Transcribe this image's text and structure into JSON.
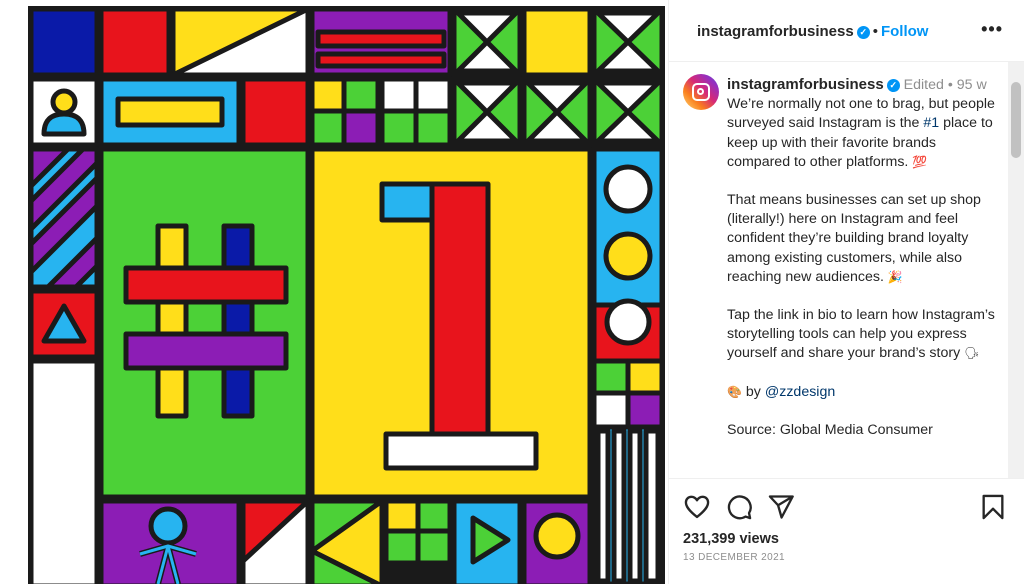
{
  "header": {
    "username": "instagramforbusiness",
    "verified_icon": "verified-badge-icon",
    "separator": "•",
    "follow_label": "Follow",
    "more_label": "•••"
  },
  "caption": {
    "username": "instagramforbusiness",
    "edited": "Edited",
    "separator": "•",
    "age": "95 w",
    "p1_before": "We’re normally not one to brag, but people surveyed said Instagram is the",
    "p1_hashtag": "#1",
    "p1_after": "place to keep up with their favorite brands compared to other platforms.",
    "p1_emoji": "💯",
    "p2": "That means businesses can set up shop (literally!) here on Instagram and feel confident they’re building brand loyalty among existing customers, while also reaching new audiences.",
    "p2_emoji": "🎉",
    "p3": "Tap the link in bio to learn how Instagram’s storytelling tools can help you express yourself and share your brand’s story",
    "p3_emoji": "🗣",
    "p4_emoji": "🎨",
    "p4_by": "by",
    "p4_mention": "@zzdesign",
    "p5": "Source: Global Media Consumer"
  },
  "actions": {
    "like_icon": "heart-icon",
    "comment_icon": "comment-icon",
    "share_icon": "paper-plane-icon",
    "save_icon": "bookmark-icon",
    "views": "231,399 views",
    "date": "13 December 2021"
  },
  "colors": {
    "accent": "#0095f6",
    "red": "#e8141c",
    "yellow": "#ffde1a",
    "green": "#4cd137",
    "blue": "#0a1aa8",
    "cyan": "#27b4f0",
    "purple": "#8c1db5"
  }
}
